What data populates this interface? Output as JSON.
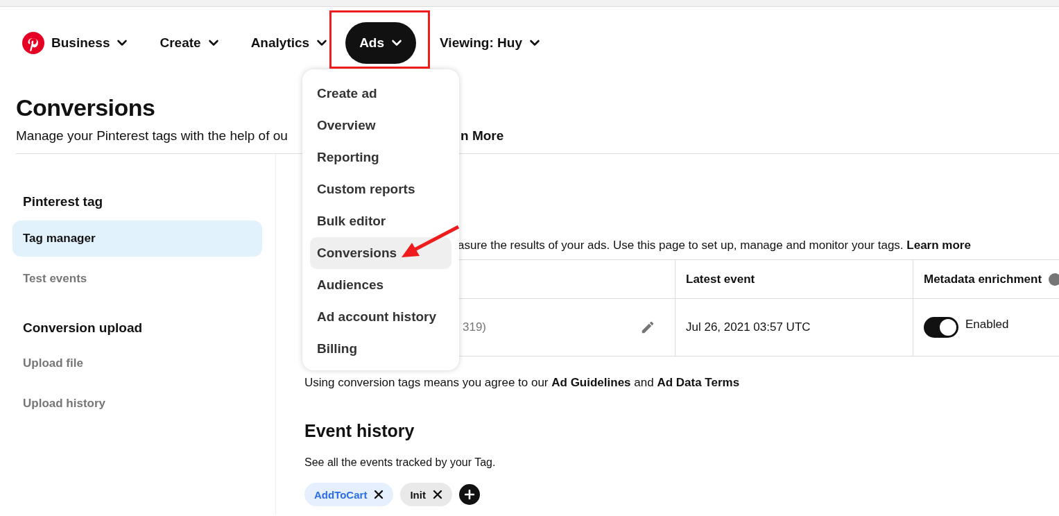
{
  "nav": [
    {
      "label": "Business",
      "kind": "logo",
      "selected": false
    },
    {
      "label": "Create",
      "kind": "menu",
      "selected": false
    },
    {
      "label": "Analytics",
      "kind": "menu",
      "selected": false
    },
    {
      "label": "Ads",
      "kind": "menu",
      "selected": true
    },
    {
      "label": "Viewing: Huy",
      "kind": "menu",
      "selected": false
    }
  ],
  "page": {
    "title": "Conversions",
    "subtitle_start": "Manage your Pinterest tags with the help of ou",
    "subtitle_end": "n More"
  },
  "ads_menu": [
    {
      "label": "Create ad",
      "selected": false
    },
    {
      "label": "Overview",
      "selected": false
    },
    {
      "label": "Reporting",
      "selected": false
    },
    {
      "label": "Custom reports",
      "selected": false
    },
    {
      "label": "Bulk editor",
      "selected": false
    },
    {
      "label": "Conversions",
      "selected": true
    },
    {
      "label": "Audiences",
      "selected": false
    },
    {
      "label": "Ad account history",
      "selected": false
    },
    {
      "label": "Billing",
      "selected": false
    }
  ],
  "sidebar": [
    {
      "heading": "Pinterest tag",
      "items": [
        {
          "label": "Tag manager",
          "selected": true
        },
        {
          "label": "Test events",
          "selected": false
        }
      ]
    },
    {
      "heading": "Conversion upload",
      "items": [
        {
          "label": "Upload file",
          "selected": false
        },
        {
          "label": "Upload history",
          "selected": false
        }
      ]
    }
  ],
  "intro": {
    "text": "asure the results of your ads. Use this page to set up, manage and monitor your tags.",
    "link": "Learn more"
  },
  "table": {
    "columns": [
      "Latest event",
      "Metadata enrichment"
    ],
    "rows": [
      {
        "tag": "319)",
        "latest_event": "Jul 26, 2021 03:57 UTC",
        "enrichment_on": true,
        "enrichment_label": "Enabled"
      }
    ]
  },
  "terms": "Using conversion tags means you agree to our **Ad Guidelines** and **Ad Data Terms**",
  "event_history": {
    "title": "Event history",
    "description": "See all the events tracked by your Tag.",
    "events": [
      {
        "label": "AddToCart",
        "selected": true
      },
      {
        "label": "Init",
        "selected": false
      }
    ]
  },
  "highlight_frame": {
    "color": "#ee1c1c"
  },
  "pointer_arrow": {
    "color": "#ee1c1c"
  }
}
